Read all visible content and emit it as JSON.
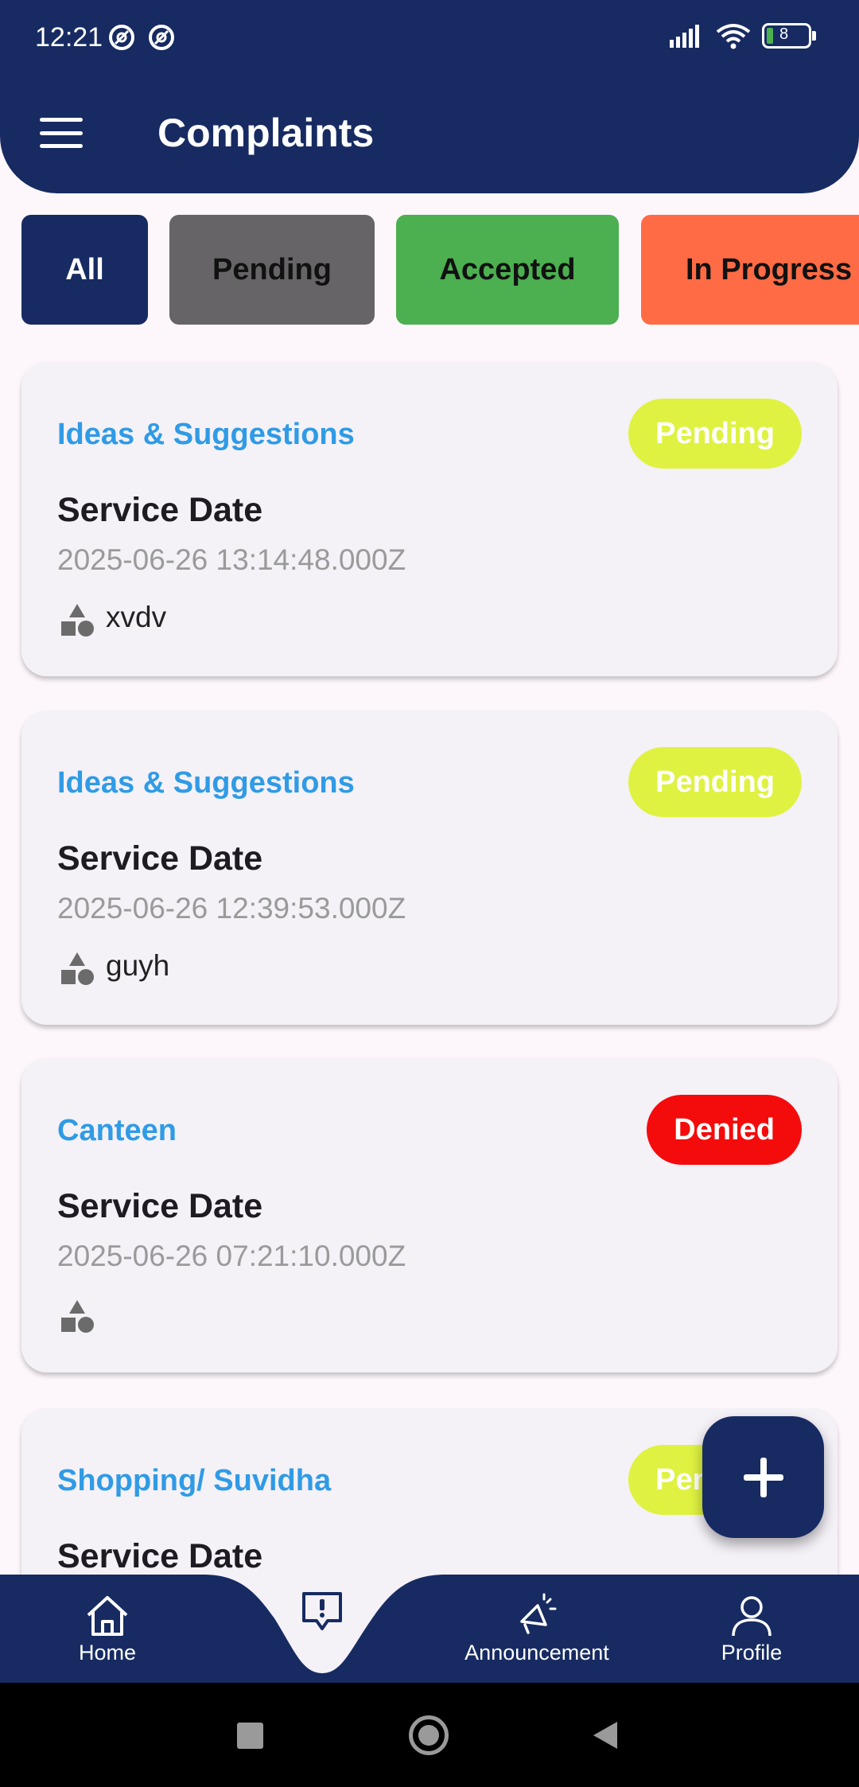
{
  "status_bar": {
    "time": "12:21",
    "battery": "8"
  },
  "header": {
    "title": "Complaints"
  },
  "filters": [
    {
      "label": "All"
    },
    {
      "label": "Pending"
    },
    {
      "label": "Accepted"
    },
    {
      "label": "In Progress"
    }
  ],
  "cards": [
    {
      "category": "Ideas & Suggestions",
      "status": "Pending",
      "label": "Service Date",
      "date": "2025-06-26 13:14:48.000Z",
      "description": "xvdv"
    },
    {
      "category": "Ideas & Suggestions",
      "status": "Pending",
      "label": "Service Date",
      "date": "2025-06-26 12:39:53.000Z",
      "description": "guyh"
    },
    {
      "category": "Canteen",
      "status": "Denied",
      "label": "Service Date",
      "date": "2025-06-26 07:21:10.000Z",
      "description": ""
    },
    {
      "category": "Shopping/ Suvidha",
      "status": "Pending",
      "label": "Service Date"
    }
  ],
  "bottom_nav": [
    {
      "label": "Home",
      "icon": "home-icon"
    },
    {
      "label": "",
      "icon": "complaint-icon"
    },
    {
      "label": "Announcement",
      "icon": "megaphone-icon"
    },
    {
      "label": "Profile",
      "icon": "person-icon"
    }
  ],
  "colors": {
    "primary": "#172b62",
    "category": "#2f9be6",
    "pending_badge": "#dff241",
    "denied_badge": "#f40c0c",
    "chip_pending": "#666466",
    "chip_accepted": "#4caf50",
    "chip_in_progress": "#ff6b45"
  }
}
